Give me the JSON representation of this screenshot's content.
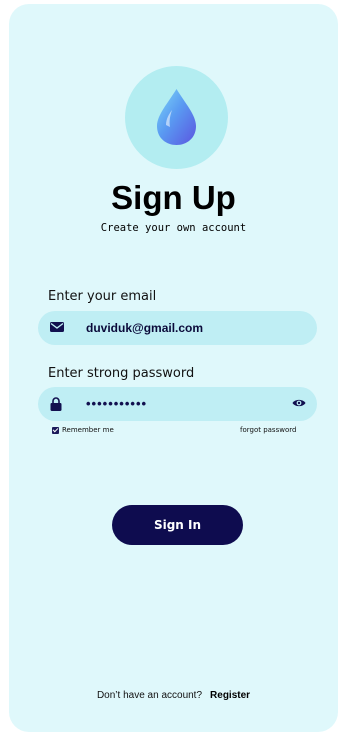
{
  "header": {
    "title": "Sign Up",
    "subtitle": "Create your own account",
    "logo_icon": "water-drop-icon"
  },
  "form": {
    "email_label": "Enter your email",
    "email_value": "duviduk@gmail.com",
    "email_icon": "mail-icon",
    "password_label": "Enter strong password",
    "password_value": "•••••••••••",
    "password_icon": "lock-icon",
    "password_toggle_icon": "eye-icon",
    "remember_label": "Remember me",
    "remember_checked": true,
    "forgot_label": "forgot password"
  },
  "actions": {
    "signin_label": "Sign In"
  },
  "footer": {
    "prompt": "Don’t have an account?",
    "register_label": "Register"
  },
  "colors": {
    "background": "#dff8fb",
    "field_background": "#bfeef4",
    "logo_circle": "#b3edf1",
    "primary": "#0e0c4f",
    "drop_blue": "#4f7df0"
  }
}
